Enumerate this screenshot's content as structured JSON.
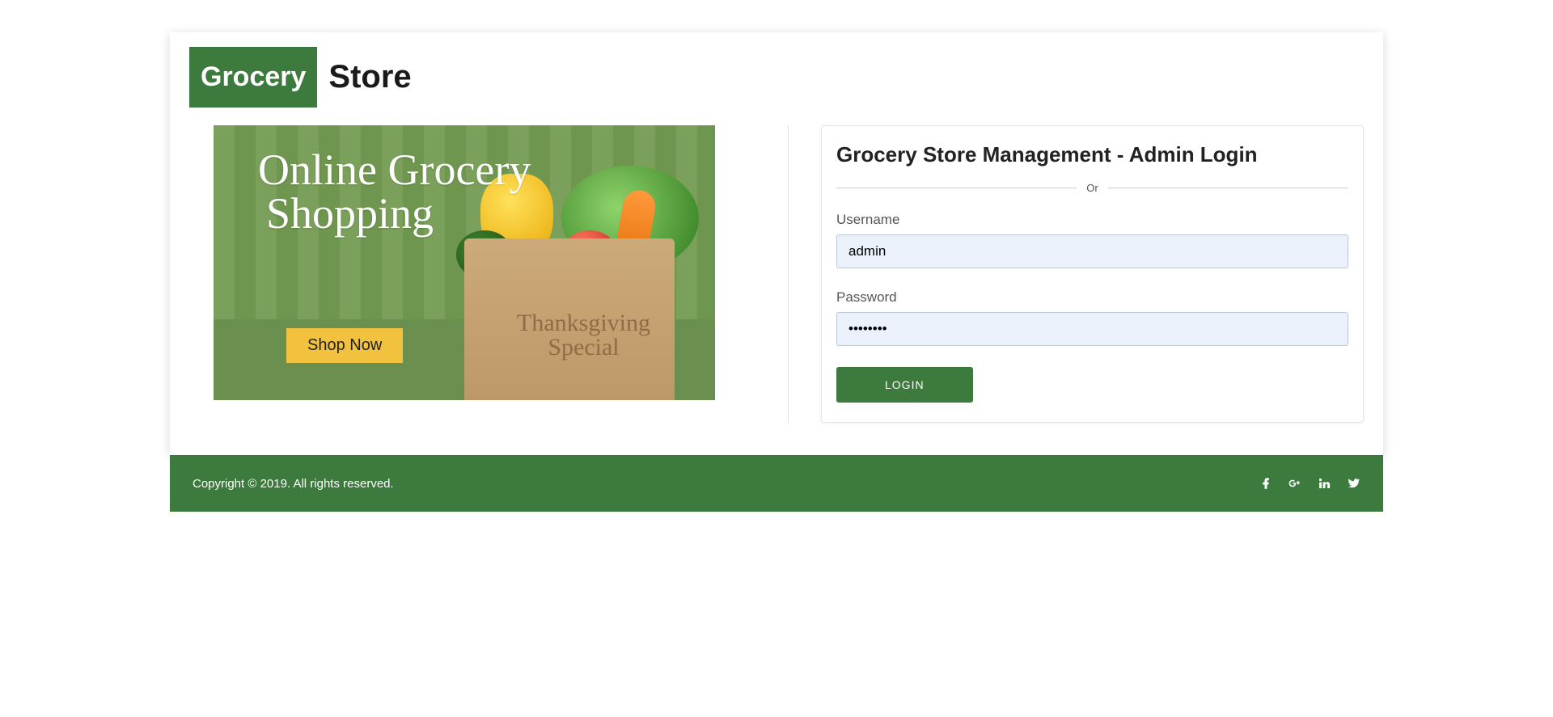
{
  "brand": {
    "badge": "Grocery",
    "suffix": "Store"
  },
  "banner": {
    "line1": "Online Grocery",
    "line2": "Shopping",
    "cta": "Shop Now",
    "bag_line1": "Thanksgiving",
    "bag_line2": "Special"
  },
  "login": {
    "title": "Grocery Store Management - Admin Login",
    "separator": "Or",
    "username_label": "Username",
    "username_value": "admin",
    "password_label": "Password",
    "password_value": "••••••••",
    "button": "LOGIN"
  },
  "footer": {
    "copyright": "Copyright © 2019. All rights reserved."
  }
}
